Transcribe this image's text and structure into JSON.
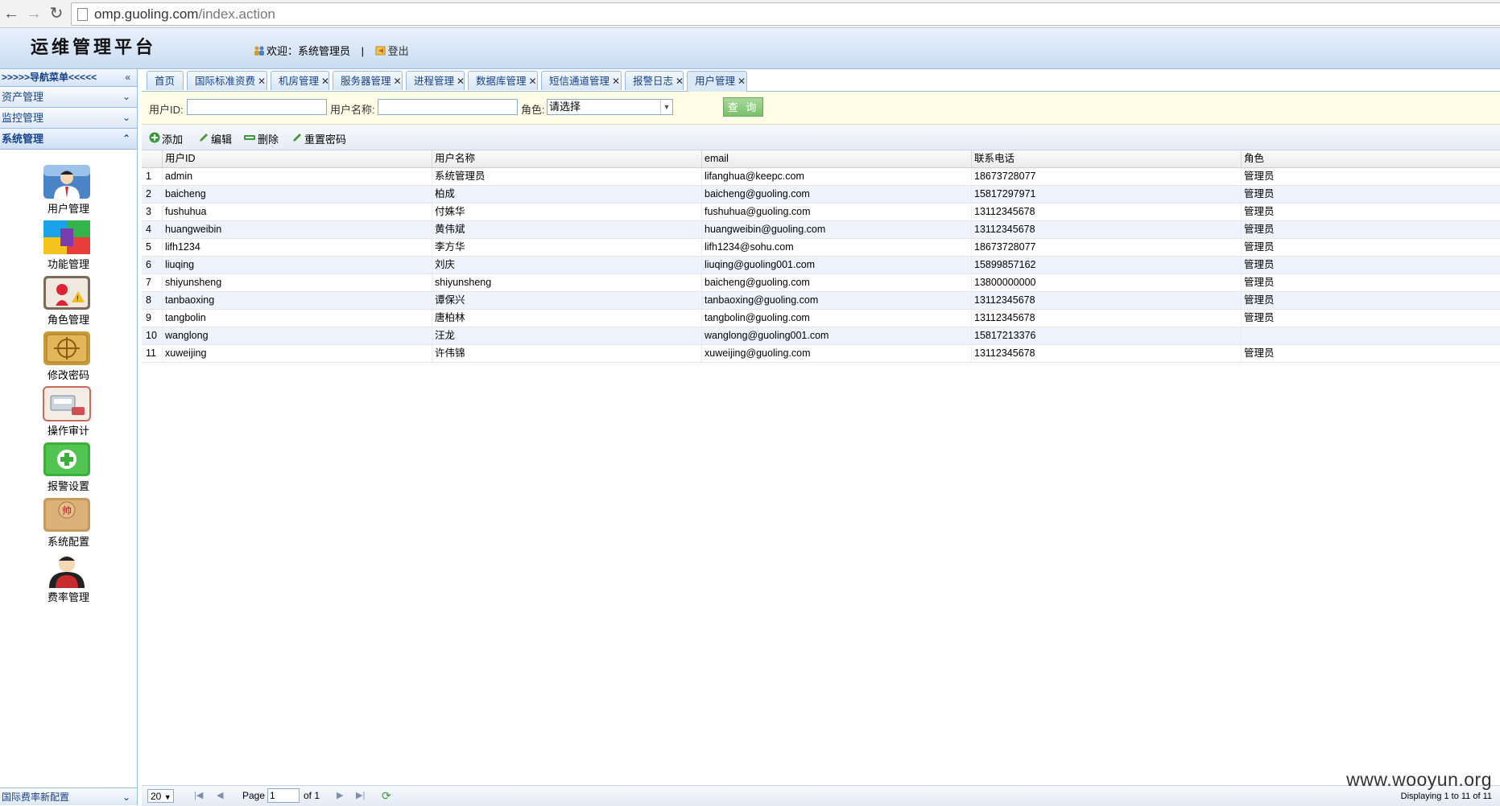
{
  "browser": {
    "url_host": "omp.guoling.com",
    "url_path": "/index.action"
  },
  "header": {
    "title": "运维管理平台",
    "welcome": "欢迎：",
    "user": "系统管理员",
    "sep": "|",
    "logout": "登出"
  },
  "sidebar": {
    "nav_title": ">>>>>导航菜单<<<<<",
    "collapse": "«",
    "sections": [
      {
        "label": "资产管理",
        "chevron": "⌄"
      },
      {
        "label": "监控管理",
        "chevron": "⌄"
      },
      {
        "label": "系统管理",
        "chevron": "⌃"
      }
    ],
    "items": [
      {
        "label": "用户管理",
        "icon": "user-icon"
      },
      {
        "label": "功能管理",
        "icon": "function-blocks-icon"
      },
      {
        "label": "角色管理",
        "icon": "role-icon"
      },
      {
        "label": "修改密码",
        "icon": "password-icon"
      },
      {
        "label": "操作审计",
        "icon": "audit-icon"
      },
      {
        "label": "报警设置",
        "icon": "alarm-icon"
      },
      {
        "label": "系统配置",
        "icon": "config-icon"
      },
      {
        "label": "费率管理",
        "icon": "rate-icon"
      }
    ],
    "footer": "国际费率新配置"
  },
  "tabs": [
    {
      "label": "首页",
      "closable": false
    },
    {
      "label": "国际标准资费",
      "closable": true
    },
    {
      "label": "机房管理",
      "closable": true
    },
    {
      "label": "服务器管理",
      "closable": true
    },
    {
      "label": "进程管理",
      "closable": true
    },
    {
      "label": "数据库管理",
      "closable": true
    },
    {
      "label": "短信通道管理",
      "closable": true
    },
    {
      "label": "报警日志",
      "closable": true
    },
    {
      "label": "用户管理",
      "closable": true,
      "active": true
    }
  ],
  "search": {
    "user_id_label": "用户ID:",
    "user_id_value": "",
    "user_name_label": "用户名称:",
    "user_name_value": "",
    "role_label": "角色:",
    "role_selected": "请选择",
    "query_button": "查 询"
  },
  "toolbar": {
    "add": "添加",
    "edit": "编辑",
    "delete": "删除",
    "reset_password": "重置密码"
  },
  "grid": {
    "columns": [
      "用户ID",
      "用户名称",
      "email",
      "联系电话",
      "角色"
    ],
    "rows": [
      {
        "n": "1",
        "id": "admin",
        "name": "系统管理员",
        "email": "lifanghua@keepc.com",
        "phone": "18673728077",
        "role": "管理员"
      },
      {
        "n": "2",
        "id": "baicheng",
        "name": "柏成",
        "email": "baicheng@guoling.com",
        "phone": "15817297971",
        "role": "管理员"
      },
      {
        "n": "3",
        "id": "fushuhua",
        "name": "付姝华",
        "email": "fushuhua@guoling.com",
        "phone": "13112345678",
        "role": "管理员"
      },
      {
        "n": "4",
        "id": "huangweibin",
        "name": "黄伟斌",
        "email": "huangweibin@guoling.com",
        "phone": "13112345678",
        "role": "管理员"
      },
      {
        "n": "5",
        "id": "lifh1234",
        "name": "李方华",
        "email": "lifh1234@sohu.com",
        "phone": "18673728077",
        "role": "管理员"
      },
      {
        "n": "6",
        "id": "liuqing",
        "name": "刘庆",
        "email": "liuqing@guoling001.com",
        "phone": "15899857162",
        "role": "管理员"
      },
      {
        "n": "7",
        "id": "shiyunsheng",
        "name": "shiyunsheng",
        "email": "baicheng@guoling.com",
        "phone": "13800000000",
        "role": "管理员"
      },
      {
        "n": "8",
        "id": "tanbaoxing",
        "name": "谭保兴",
        "email": "tanbaoxing@guoling.com",
        "phone": "13112345678",
        "role": "管理员"
      },
      {
        "n": "9",
        "id": "tangbolin",
        "name": "唐柏林",
        "email": "tangbolin@guoling.com",
        "phone": "13112345678",
        "role": "管理员"
      },
      {
        "n": "10",
        "id": "wanglong",
        "name": "汪龙",
        "email": "wanglong@guoling001.com",
        "phone": "15817213376",
        "role": ""
      },
      {
        "n": "11",
        "id": "xuweijing",
        "name": "许伟锦",
        "email": "xuweijing@guoling.com",
        "phone": "13112345678",
        "role": "管理员"
      }
    ]
  },
  "pager": {
    "page_size": "20",
    "page_label": "Page",
    "page_value": "1",
    "of_label": "of 1",
    "display": "Displaying 1 to 11 of 11"
  },
  "watermark": "www.wooyun.org"
}
